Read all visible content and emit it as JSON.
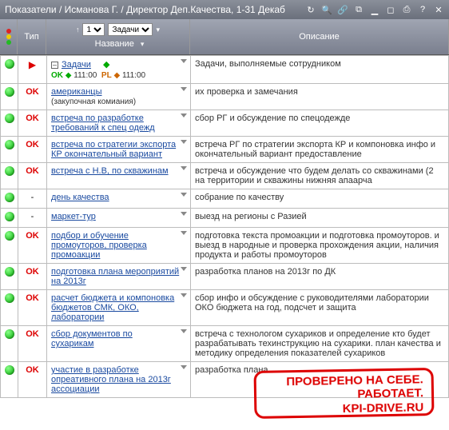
{
  "titlebar": {
    "text": "Показатели / Исманова Г. / Директор Деп.Качества, 1-31 Декаб"
  },
  "header": {
    "type_label": "Тип",
    "page_value": "1",
    "tasks_label": "Задачи",
    "title_label": "Название",
    "desc_label": "Описание"
  },
  "rows": [
    {
      "status": "green",
      "type": "play",
      "title": "Задачи",
      "title_prefix": "tree",
      "title_diamond": true,
      "kpi_ok": "111:00",
      "kpi_pl": "111:00",
      "desc": "Задачи, выполняемые сотрудником"
    },
    {
      "status": "green",
      "type": "ok",
      "title": "американцы",
      "subtext": "(закупочная комиания)",
      "desc": "их проверка и замечания"
    },
    {
      "status": "green",
      "type": "ok",
      "title": "встреча по разработке требований к спец одежд",
      "desc": "сбор РГ и обсуждение по спецодежде"
    },
    {
      "status": "green",
      "type": "ok",
      "title": "встреча по стратегии экспорта КР окончательный вариант",
      "desc": "встреча РГ по стратегии экспорта КР и компоновка инфо и окончательный вариант предоставление"
    },
    {
      "status": "green",
      "type": "ok",
      "title": "встреча с Н.В, по скважинам",
      "desc": "встреча и обсуждение что будем делать со скважинами (2 на территории и скважины нижняя апаарча"
    },
    {
      "status": "green",
      "type": "dash",
      "title": "день качества",
      "desc": "собрание по качеству"
    },
    {
      "status": "green",
      "type": "dash",
      "title": "маркет-тур",
      "desc": "выезд на регионы с Разией"
    },
    {
      "status": "green",
      "type": "ok",
      "title": "подбор и обучение промоуторов, проверка промоакции",
      "desc": "подготовка текста промоакции и подготовка промоуторов. и выезд в народные и проверка прохождения акции, наличия продукта и работы промоуторов"
    },
    {
      "status": "green",
      "type": "ok",
      "title": "подготовка плана мероприятий на 2013г",
      "desc": "разработка планов на 2013г по ДК"
    },
    {
      "status": "green",
      "type": "ok",
      "title": "расчет бюджета и компоновка бюджетов СМК, ОКО, лаборатории",
      "desc": "сбор инфо и обсуждение с руководителями лаборатории ОКО бюджета на год, подсчет и защита"
    },
    {
      "status": "green",
      "type": "ok",
      "title": "сбор документов по сухарикам",
      "desc": "встреча с технологом сухариков и определение кто будет разрабатывать техинструкцию на сухарики. план качества и методику определения показателей сухариков"
    },
    {
      "status": "green",
      "type": "ok",
      "title": "участие в разработке опреативного плана на 2013г ассоциации",
      "desc": "разработка плана"
    }
  ],
  "stamp": {
    "line1": "ПРОВЕРЕНО НА СЕБЕ.",
    "line2": "РАБОТАЕТ.",
    "line3": "KPI-DRIVE.RU"
  }
}
